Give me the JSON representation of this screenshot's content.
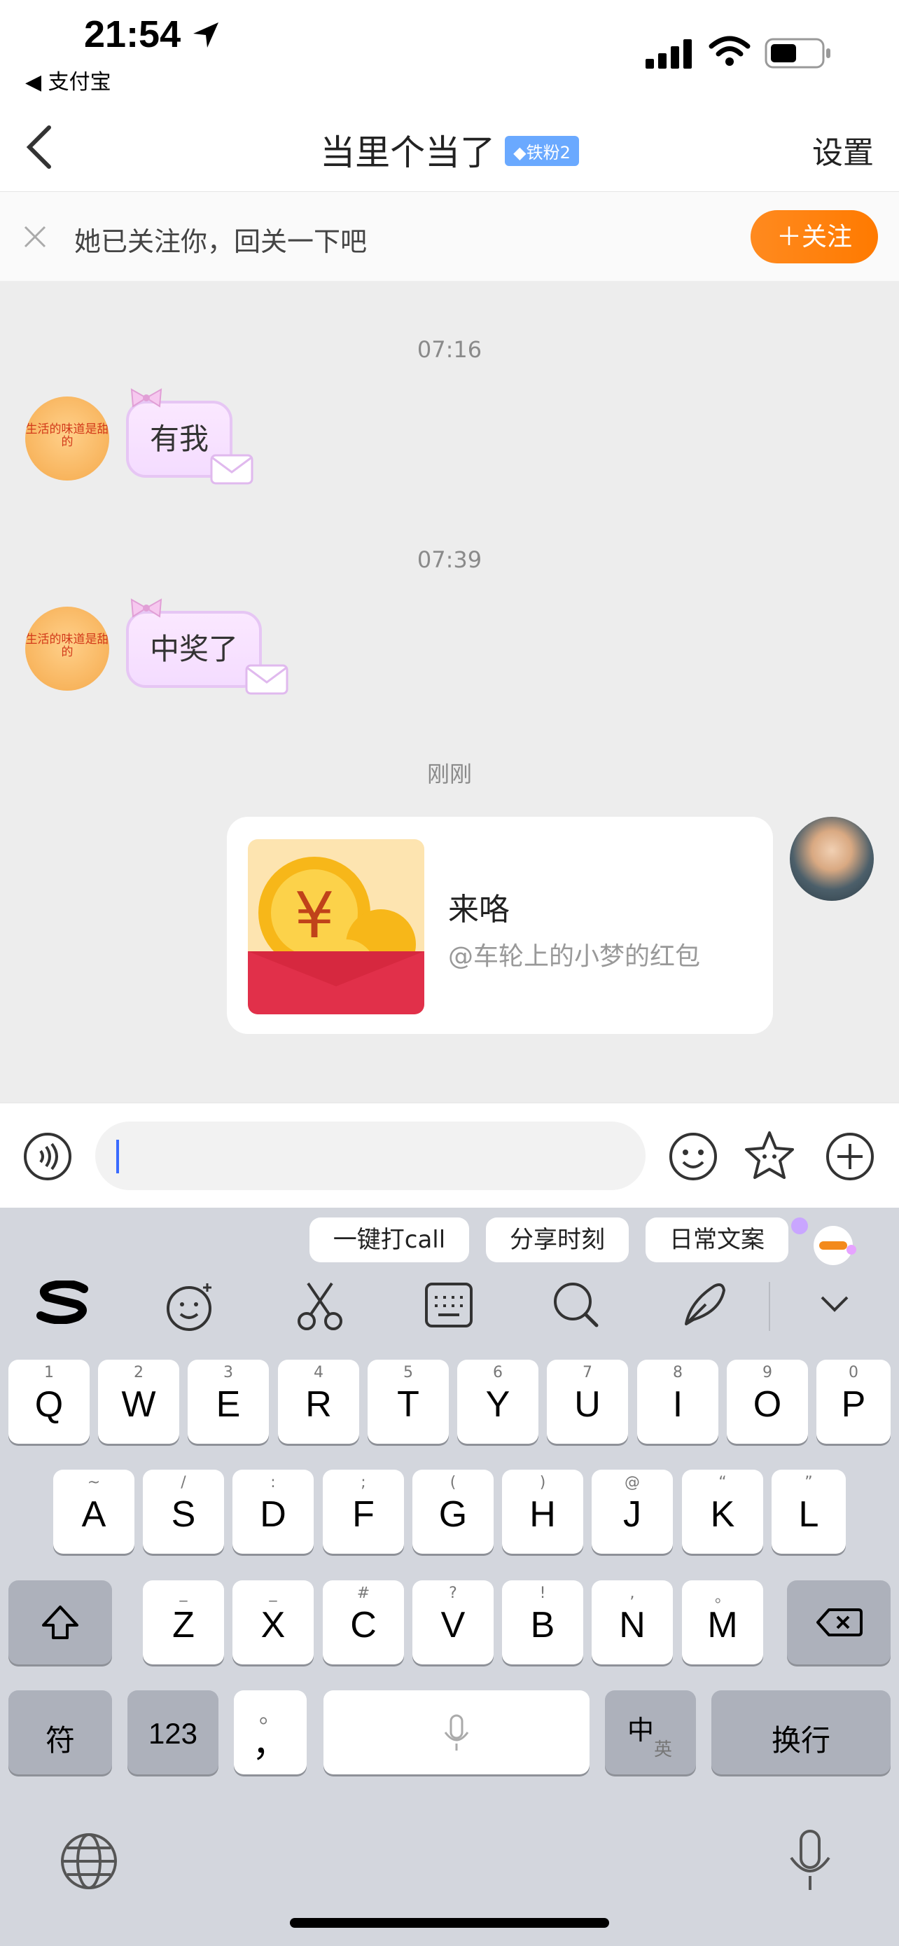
{
  "status_bar": {
    "time": "21:54",
    "back_app": "◀ 支付宝"
  },
  "header": {
    "title": "当里个当了",
    "badge": "◆铁粉2",
    "settings": "设置"
  },
  "follow_bar": {
    "text": "她已关注你，回关一下吧",
    "button": "＋关注"
  },
  "messages": [
    {
      "timestamp": "07:16",
      "text": "有我"
    },
    {
      "timestamp": "07:39",
      "text": "中奖了"
    },
    {
      "timestamp": "刚刚",
      "red_packet_title": "来咯",
      "red_packet_sub": "@车轮上的小梦的红包"
    }
  ],
  "avatar_text": "生活的味道是甜的",
  "input": {
    "placeholder": ""
  },
  "keyboard": {
    "suggestions": [
      "一键打call",
      "分享时刻",
      "日常文案"
    ],
    "row1": [
      [
        "Q",
        "1"
      ],
      [
        "W",
        "2"
      ],
      [
        "E",
        "3"
      ],
      [
        "R",
        "4"
      ],
      [
        "T",
        "5"
      ],
      [
        "Y",
        "6"
      ],
      [
        "U",
        "7"
      ],
      [
        "I",
        "8"
      ],
      [
        "O",
        "9"
      ],
      [
        "P",
        "0"
      ]
    ],
    "row2": [
      [
        "A",
        "~"
      ],
      [
        "S",
        "/"
      ],
      [
        "D",
        ":"
      ],
      [
        "F",
        ";"
      ],
      [
        "G",
        "("
      ],
      [
        "H",
        ")"
      ],
      [
        "J",
        "@"
      ],
      [
        "K",
        "“"
      ],
      [
        "L",
        "”"
      ]
    ],
    "row3": [
      [
        "Z",
        "_"
      ],
      [
        "X",
        "_"
      ],
      [
        "C",
        "#"
      ],
      [
        "V",
        "?"
      ],
      [
        "B",
        "!"
      ],
      [
        "N",
        ","
      ],
      [
        "M",
        "。"
      ]
    ],
    "fu": "符",
    "num": "123",
    "comma": "，",
    "zh": "中",
    "en": "英",
    "enter": "换行"
  }
}
